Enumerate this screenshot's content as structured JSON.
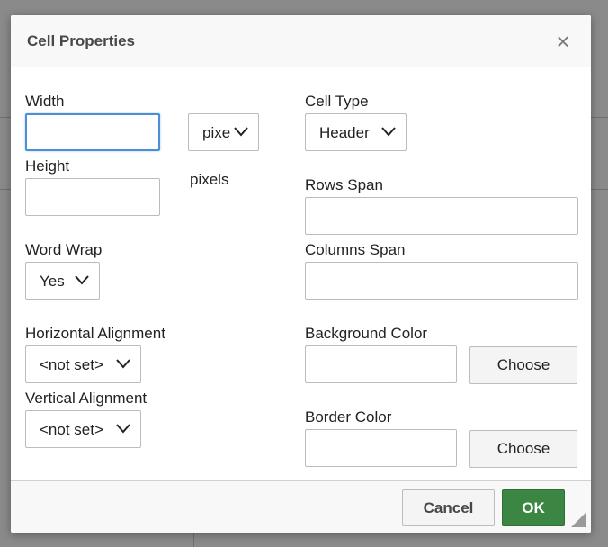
{
  "dialog": {
    "title": "Cell Properties",
    "close_glyph": "×"
  },
  "fields": {
    "width": {
      "label": "Width",
      "value": ""
    },
    "width_unit": {
      "value": "pixels"
    },
    "height": {
      "label": "Height",
      "value": ""
    },
    "height_unit": {
      "label": "pixels"
    },
    "word_wrap": {
      "label": "Word Wrap",
      "value": "Yes"
    },
    "horizontal_alignment": {
      "label": "Horizontal Alignment",
      "value": "<not set>"
    },
    "vertical_alignment": {
      "label": "Vertical Alignment",
      "value": "<not set>"
    },
    "cell_type": {
      "label": "Cell Type",
      "value": "Header"
    },
    "rows_span": {
      "label": "Rows Span",
      "value": ""
    },
    "columns_span": {
      "label": "Columns Span",
      "value": ""
    },
    "background_color": {
      "label": "Background Color",
      "value": "",
      "choose_label": "Choose"
    },
    "border_color": {
      "label": "Border Color",
      "value": "",
      "choose_label": "Choose"
    }
  },
  "footer": {
    "cancel_label": "Cancel",
    "ok_label": "OK"
  },
  "icons": {
    "close": "close-icon",
    "chevron": "chevron-down-icon",
    "resize": "resize-handle-icon"
  },
  "colors": {
    "ok_button": "#3a8642",
    "focus_ring": "#4c8fd6",
    "overlay": "#8a8a8a"
  }
}
